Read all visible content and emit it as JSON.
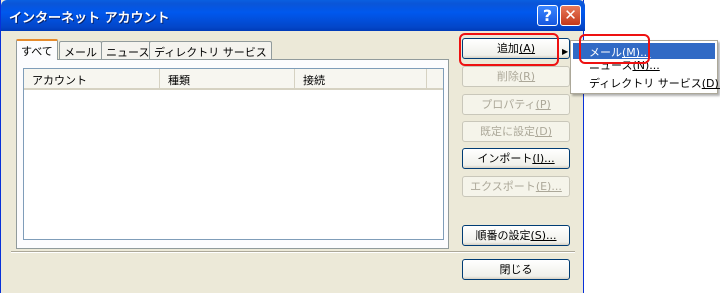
{
  "window": {
    "title": "インターネット アカウント",
    "help_glyph": "?",
    "close_glyph": "✕"
  },
  "tabs": [
    {
      "label": "すべて",
      "active": true
    },
    {
      "label": "メール",
      "active": false
    },
    {
      "label": "ニュース",
      "active": false
    },
    {
      "label": "ディレクトリ サービス",
      "active": false
    }
  ],
  "list": {
    "columns": [
      "アカウント",
      "種類",
      "接続"
    ],
    "rows": []
  },
  "buttons": {
    "add": {
      "text": "追加",
      "key": "(A)",
      "enabled": true
    },
    "remove": {
      "text": "削除",
      "key": "(R)",
      "enabled": false
    },
    "properties": {
      "text": "プロパティ",
      "key": "(P)",
      "enabled": false
    },
    "set_default": {
      "text": "既定に設定",
      "key": "(D)",
      "enabled": false
    },
    "import": {
      "text": "インポート",
      "key": "(I)...",
      "enabled": true
    },
    "export": {
      "text": "エクスポート",
      "key": "(E)...",
      "enabled": false
    },
    "order": {
      "text": "順番の設定",
      "key": "(S)...",
      "enabled": true
    },
    "close": {
      "text": "閉じる",
      "enabled": true
    }
  },
  "add_menu": [
    {
      "text": "メール",
      "key": "(M)...",
      "selected": true
    },
    {
      "text": "ニュース",
      "key": "(N)...",
      "selected": false
    },
    {
      "text": "ディレクトリ サービス",
      "key": "(D)...",
      "selected": false
    }
  ],
  "colors": {
    "title_bar": "#0058ee",
    "dialog_bg": "#ece9d8",
    "menu_selection": "#316ac5",
    "highlight_annotation": "#ee1111"
  }
}
